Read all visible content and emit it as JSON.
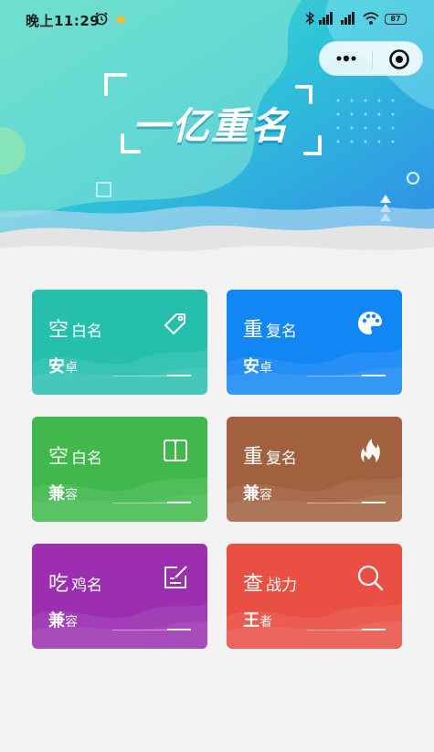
{
  "status_bar": {
    "time": "晚上11:29",
    "battery": "87"
  },
  "capsule": {
    "more_icon": "more-dots-icon",
    "close_icon": "target-close-icon"
  },
  "banner": {
    "title": "一亿重名"
  },
  "colors": {
    "card_1": "#26bfae",
    "card_2": "#1386f5",
    "card_3": "#41b84c",
    "card_4": "#a1603e",
    "card_5": "#9b2fb0",
    "card_6": "#e94f43"
  },
  "cards": [
    {
      "title_first": "空",
      "title_rest": "白名",
      "sub_first": "安",
      "sub_rest": "卓",
      "icon": "tag-icon"
    },
    {
      "title_first": "重",
      "title_rest": "复名",
      "sub_first": "安",
      "sub_rest": "卓",
      "icon": "palette-icon"
    },
    {
      "title_first": "空",
      "title_rest": "白名",
      "sub_first": "兼",
      "sub_rest": "容",
      "icon": "book-icon"
    },
    {
      "title_first": "重",
      "title_rest": "复名",
      "sub_first": "兼",
      "sub_rest": "容",
      "icon": "flame-icon"
    },
    {
      "title_first": "吃",
      "title_rest": "鸡名",
      "sub_first": "兼",
      "sub_rest": "容",
      "icon": "edit-icon"
    },
    {
      "title_first": "查",
      "title_rest": "战力",
      "sub_first": "王",
      "sub_rest": "者",
      "icon": "search-icon"
    }
  ]
}
